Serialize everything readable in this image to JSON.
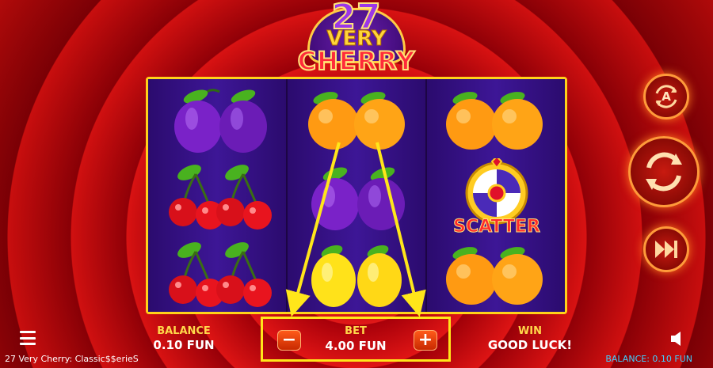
{
  "logo": {
    "number": "27",
    "line1": "VERY",
    "line2": "CHERRY"
  },
  "reels": [
    [
      "plum",
      "cherry",
      "cherry"
    ],
    [
      "orange",
      "plum",
      "lemon"
    ],
    [
      "orange",
      "scatter",
      "orange"
    ]
  ],
  "scatter_label": "SCATTER",
  "buttons": {
    "autoplay_icon_letter": "A",
    "autoplay": "autoplay-icon",
    "spin": "spin-icon",
    "turbo": "fast-forward-icon",
    "menu": "menu-icon",
    "sound": "speaker-icon"
  },
  "bottom": {
    "balance_label": "BALANCE",
    "balance_value": "0.10 FUN",
    "bet_label": "BET",
    "bet_value": "4.00 FUN",
    "bet_minus": "−",
    "bet_plus": "+",
    "win_label": "WIN",
    "win_value": "GOOD LUCK!"
  },
  "footer": {
    "game_name": "27 Very Cherry: Classic$$erieS",
    "balance_text": "BALANCE: 0.10 FUN"
  },
  "colors": {
    "accent_yellow": "#ffe61a",
    "label_gold": "#ffd84a",
    "reel_purple": "#3d1696",
    "footer_cyan": "#40d0ff"
  }
}
